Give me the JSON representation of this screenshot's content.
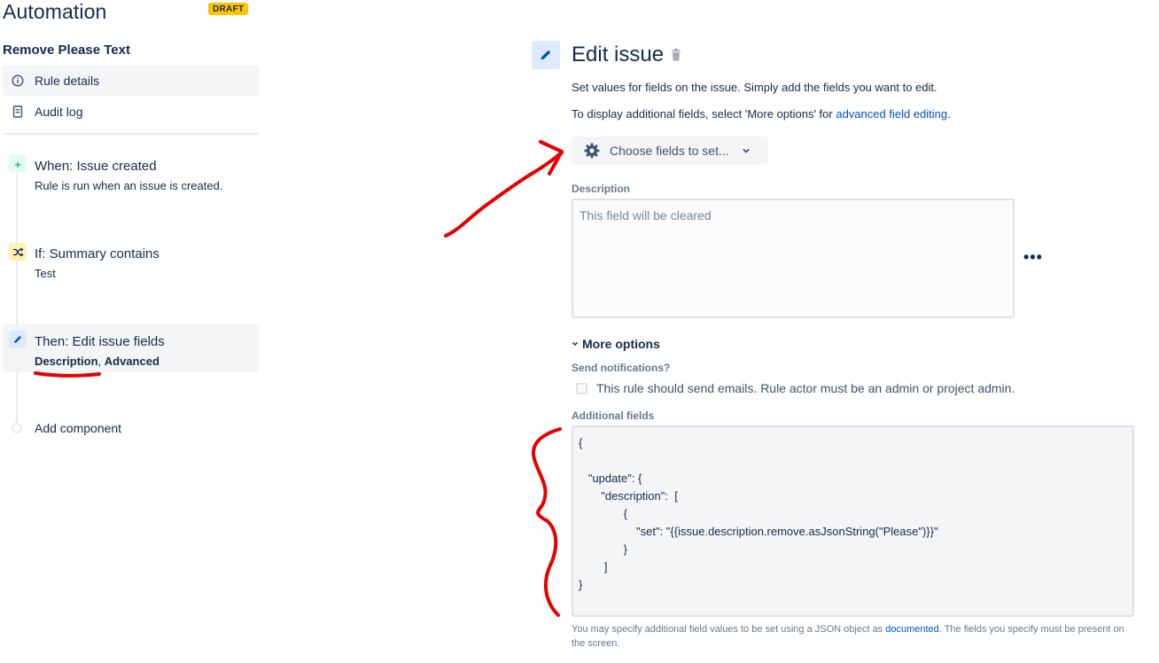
{
  "app": {
    "title": "Automation",
    "badge": "DRAFT"
  },
  "rule": {
    "name": "Remove Please Text"
  },
  "nav": [
    {
      "label": "Rule details",
      "icon": "info-icon"
    },
    {
      "label": "Audit log",
      "icon": "document-icon"
    }
  ],
  "components": {
    "trigger": {
      "title": "When: Issue created",
      "sub": "Rule is run when an issue is created.",
      "icon": "plus-icon",
      "color": "#36b37e"
    },
    "condition": {
      "title": "If: Summary contains",
      "sub": "Test",
      "icon": "shuffle-icon",
      "color": "#ffab00"
    },
    "action": {
      "title": "Then: Edit issue fields",
      "sub_field1": "Description",
      "sub_sep": ", ",
      "sub_field2": "Advanced",
      "icon": "pencil-icon",
      "color": "#0052cc"
    },
    "add_label": "Add component"
  },
  "edit": {
    "title": "Edit issue",
    "line1": "Set values for fields on the issue. Simply add the fields you want to edit.",
    "line2_prefix": "To display additional fields, select 'More options' for ",
    "line2_link": "advanced field editing",
    "line2_suffix": ".",
    "choose_label": "Choose fields to set...",
    "description_label": "Description",
    "description_placeholder": "This field will be cleared",
    "more_options_label": "More options",
    "send_notifications_label": "Send notifications?",
    "send_checkbox_label": "This rule should send emails. Rule actor must be an admin or project admin.",
    "additional_fields_label": "Additional fields",
    "json_lines": [
      "{",
      "",
      "   \"update\": {",
      "       \"description\":  [",
      "              {",
      "                  \"set\": \"{{issue.description.remove.asJsonString(\"Please\")}}\"",
      "              }",
      "        ]",
      "}"
    ],
    "help_prefix": "You may specify additional field values to be set using a JSON object as ",
    "help_link": "documented",
    "help_suffix": ". The fields you specify must be present on the screen."
  },
  "colors": {
    "accent": "#0052cc",
    "draft": "#ffc400",
    "annotation": "#e60000"
  }
}
